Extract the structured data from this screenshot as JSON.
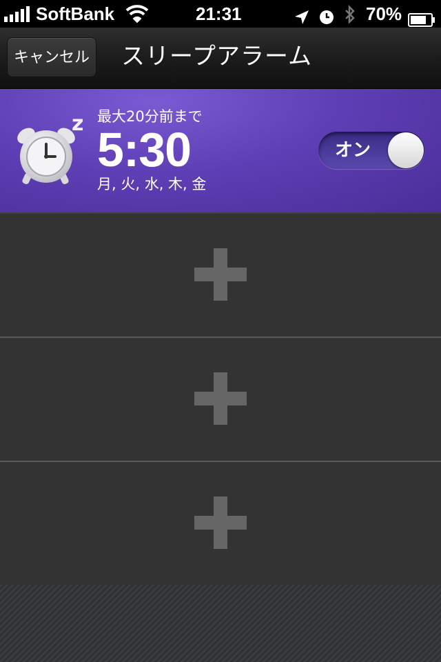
{
  "status_bar": {
    "carrier": "SoftBank",
    "time": "21:31",
    "battery": "70%",
    "icons": [
      "signal-icon",
      "wifi-icon",
      "location-icon",
      "alarm-icon",
      "bluetooth-icon",
      "battery-icon"
    ]
  },
  "nav": {
    "cancel_label": "キャンセル",
    "title": "スリープアラーム"
  },
  "alarm": {
    "window_label": "最大20分前まで",
    "time": "5:30",
    "days": "月, 火, 水, 木, 金",
    "toggle_label": "オン",
    "enabled": true,
    "accent_color": "#6a4cc4"
  },
  "empty_slots": [
    {
      "icon": "plus-icon"
    },
    {
      "icon": "plus-icon"
    },
    {
      "icon": "plus-icon"
    }
  ]
}
